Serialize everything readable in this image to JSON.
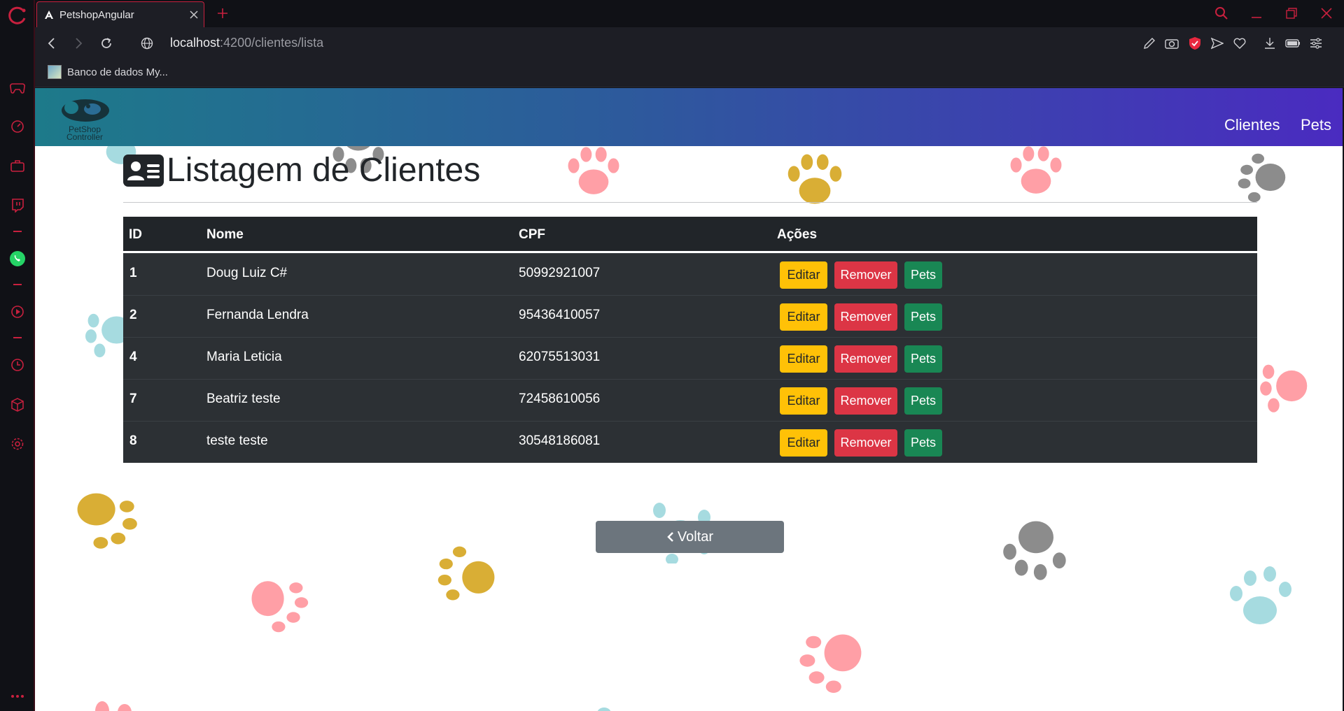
{
  "browser": {
    "tab_title": "PetshopAngular",
    "url_host": "localhost",
    "url_path": ":4200/clientes/lista",
    "bookmark_label": "Banco de dados My..."
  },
  "app": {
    "brand_line1": "PetShop",
    "brand_line2": "Controller",
    "nav_clientes": "Clientes",
    "nav_pets": "Pets",
    "page_title": "Listagem de Clientes",
    "back_label": "Voltar"
  },
  "table": {
    "headers": [
      "ID",
      "Nome",
      "CPF",
      "Ações"
    ],
    "rows": [
      {
        "id": "1",
        "nome": "Doug Luiz C#",
        "cpf": "50992921007"
      },
      {
        "id": "2",
        "nome": "Fernanda Lendra",
        "cpf": "95436410057"
      },
      {
        "id": "4",
        "nome": "Maria Leticia",
        "cpf": "62075513031"
      },
      {
        "id": "7",
        "nome": "Beatriz teste",
        "cpf": "72458610056"
      },
      {
        "id": "8",
        "nome": "teste teste",
        "cpf": "30548186081"
      }
    ],
    "actions": {
      "edit": "Editar",
      "remove": "Remover",
      "pets": "Pets"
    }
  },
  "colors": {
    "accent": "#c8203e",
    "warning": "#ffc107",
    "danger": "#dc3545",
    "success": "#198754",
    "secondary": "#6c757d"
  },
  "icons": [
    "opera-gx-logo",
    "gamepad-icon",
    "speedometer-icon",
    "briefcase-icon",
    "twitch-icon",
    "whatsapp-icon",
    "play-icon",
    "clock-icon",
    "cube-icon",
    "settings-icon",
    "more-icon",
    "search-icon",
    "address-card-icon",
    "chevron-left-icon"
  ]
}
